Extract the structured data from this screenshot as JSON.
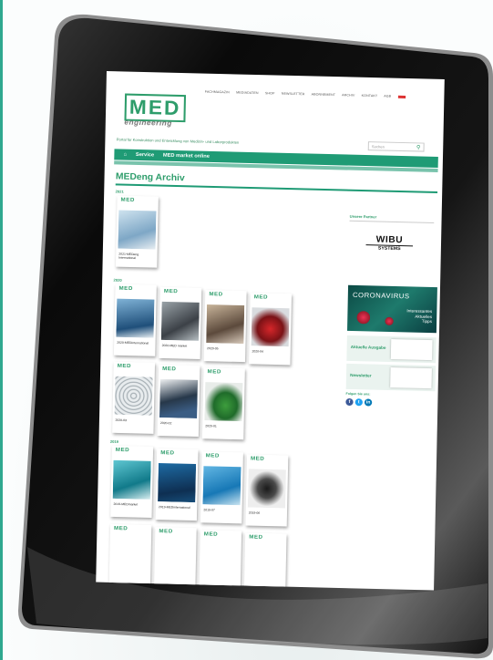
{
  "header": {
    "links": [
      "FACHMAGAZIN",
      "MEDIADATEN",
      "SHOP",
      "NEWSLETTER",
      "ABONNEMENT",
      "ARCHIV",
      "KONTAKT",
      "AGB"
    ],
    "logo_text": "MED",
    "logo_sub": "engineering",
    "tagline": "Portal für Konstruktion und Entwicklung von Medizin- und Laborprodukten",
    "search_placeholder": "Suchen"
  },
  "nav": {
    "home_icon": "home-icon",
    "items": [
      "Service",
      "MED market online"
    ]
  },
  "page": {
    "title": "MEDeng Archiv"
  },
  "archive": {
    "years": [
      "2021",
      "2020",
      "2019"
    ],
    "y2021": [
      {
        "caption": "2021-MEDeng International"
      }
    ],
    "y2020_row1": [
      {
        "caption": "2020-MEDinternational"
      },
      {
        "caption": "2020-MED market"
      },
      {
        "caption": "2020-05"
      },
      {
        "caption": "2020-04"
      }
    ],
    "y2020_row2": [
      {
        "caption": "2020-03"
      },
      {
        "caption": "2020-02"
      },
      {
        "caption": "2020-01"
      }
    ],
    "y2019_row1": [
      {
        "caption": "2019-MEDmarket"
      },
      {
        "caption": "2019-MEDinternational"
      },
      {
        "caption": "2019-07"
      },
      {
        "caption": "2019-06"
      }
    ],
    "cover_label": "MED"
  },
  "sidebar": {
    "partner_title": "Unsere Partner",
    "wibu_top": "WIBU",
    "wibu_bottom": "SYSTEMS",
    "corona_title": "CORONAVIRUS",
    "corona_sub_1": "Interessantes",
    "corona_sub_2": "Aktuelles",
    "corona_sub_3": "Tipps",
    "current_issue": "Aktuelle Ausgabe",
    "newsletter": "Newsletter",
    "follow": "Folgen Sie uns:",
    "social": [
      "f",
      "t",
      "in"
    ]
  },
  "colors": {
    "brand": "#1f9b75",
    "bezel": "#0d0d0d"
  }
}
